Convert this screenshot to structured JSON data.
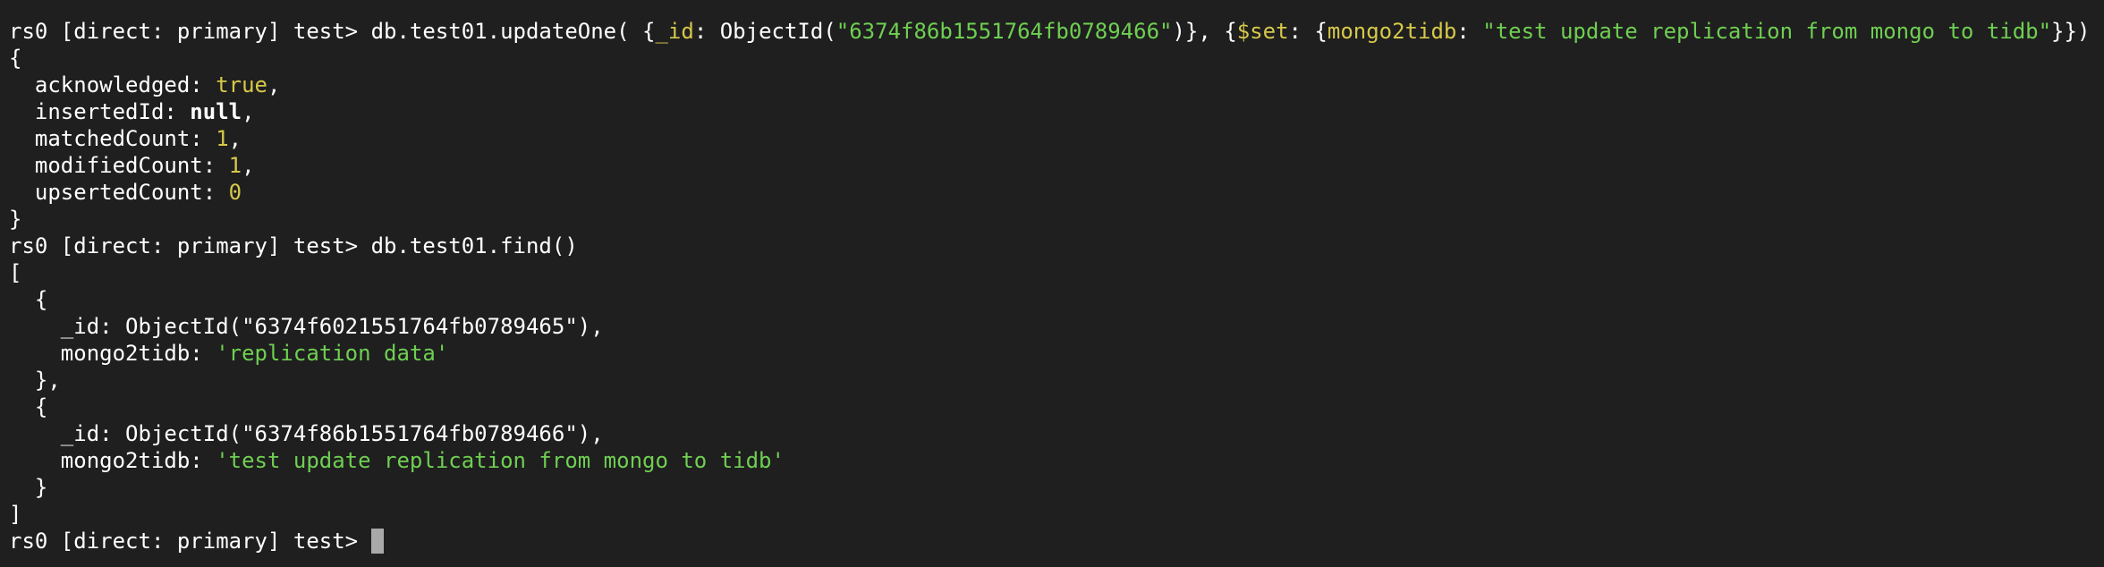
{
  "terminal": {
    "prompt": "rs0 [direct: primary] test> ",
    "cmd1": {
      "a": "db.test01.updateOne( {",
      "id_key": "_id",
      "b": ": ObjectId(",
      "oid": "\"6374f86b1551764fb0789466\"",
      "c": ")}, {",
      "set_key": "$set",
      "d": ": {",
      "field": "mongo2tidb",
      "e": ": ",
      "val": "\"test update replication from mongo to tidb\"",
      "f": "}})"
    },
    "result": {
      "open": "{",
      "ack_key": "  acknowledged: ",
      "ack_val": "true",
      "ins_key": "  insertedId: ",
      "ins_val": "null",
      "matched_key": "  matchedCount: ",
      "matched_val": "1",
      "modified_key": "  modifiedCount: ",
      "modified_val": "1",
      "upserted_key": "  upsertedCount: ",
      "upserted_val": "0",
      "comma": ",",
      "close": "}"
    },
    "cmd2": "db.test01.find()",
    "find": {
      "arr_open": "[",
      "obj_open": "  {",
      "doc1_id": "    _id: ObjectId(\"6374f6021551764fb0789465\"),",
      "field_key": "    mongo2tidb: ",
      "doc1_val": "'replication data'",
      "obj_close_comma": "  },",
      "doc2_id": "    _id: ObjectId(\"6374f86b1551764fb0789466\"),",
      "doc2_val": "'test update replication from mongo to tidb'",
      "obj_close": "  }",
      "arr_close": "]"
    }
  }
}
